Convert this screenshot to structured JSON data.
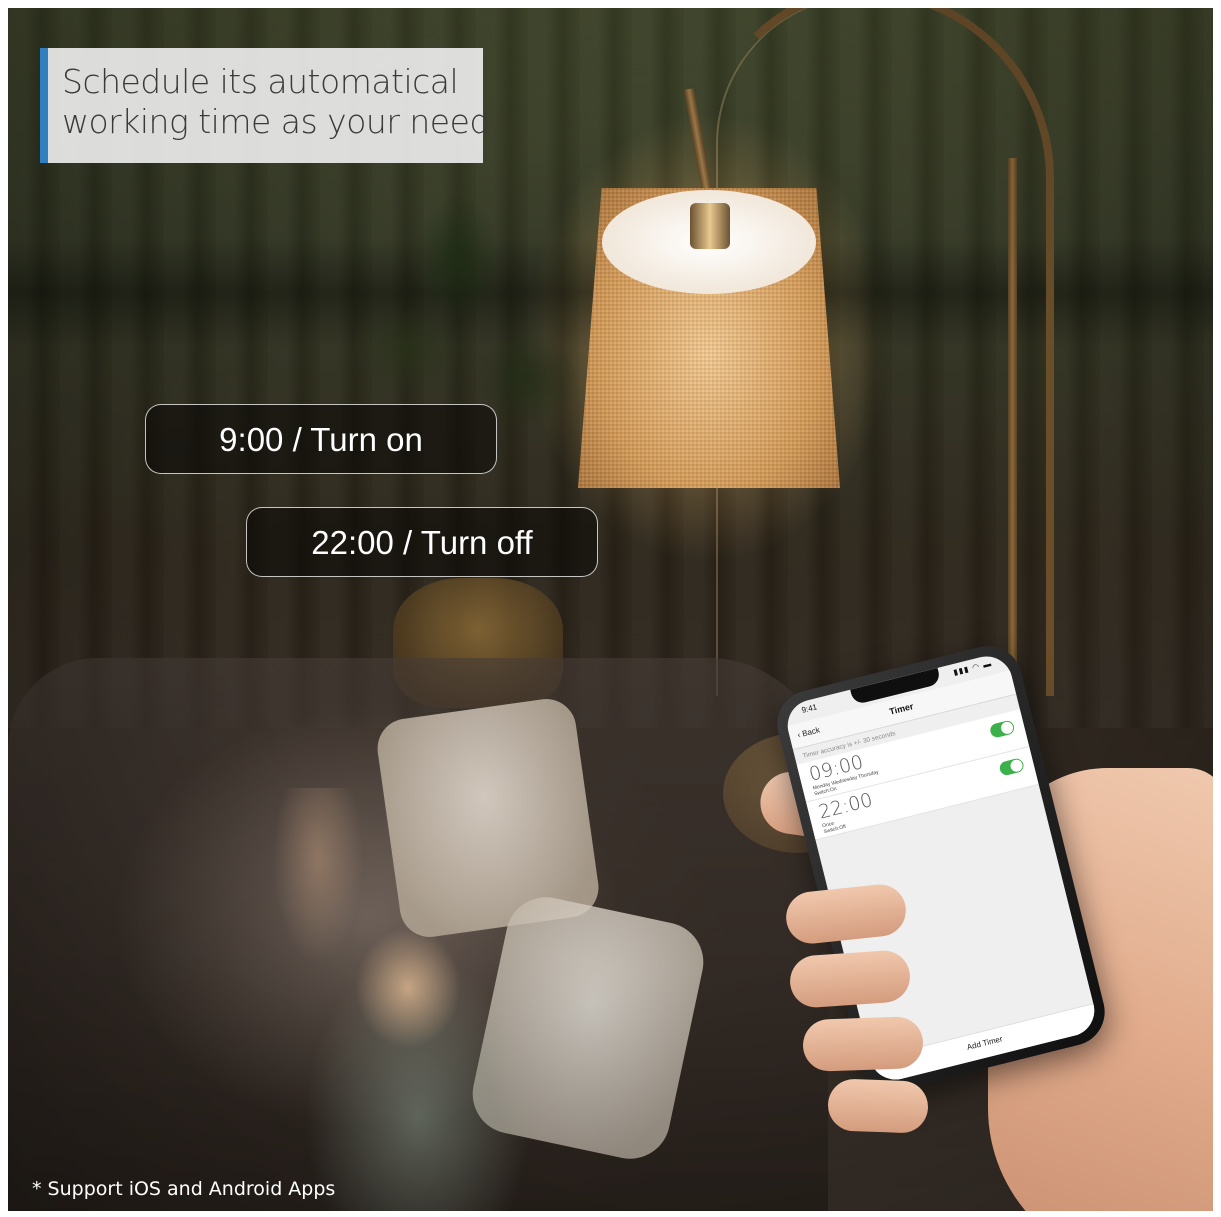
{
  "headline": {
    "line1": "Schedule its automatical",
    "line2": "working time as your need."
  },
  "pills": {
    "turn_on": "9:00 / Turn on",
    "turn_off": "22:00 / Turn off"
  },
  "footnote": "* Support iOS and Android Apps",
  "phone": {
    "status_time": "9:41",
    "status_icons": "▮▮▮ ◠ ▬",
    "nav": {
      "back_label": "‹ Back",
      "title": "Timer"
    },
    "accuracy_note": "Timer accuracy is +/- 30 seconds",
    "timers": [
      {
        "time": "09:00",
        "days": "Monday Wednesday Thursday",
        "action": "Switch:On",
        "enabled": true
      },
      {
        "time": "22:00",
        "days": "Once",
        "action": "Switch:Off",
        "enabled": true
      }
    ],
    "add_label": "Add Timer"
  },
  "colors": {
    "accent_bar": "#2f7fc1",
    "toggle_on": "#3cb04a"
  }
}
